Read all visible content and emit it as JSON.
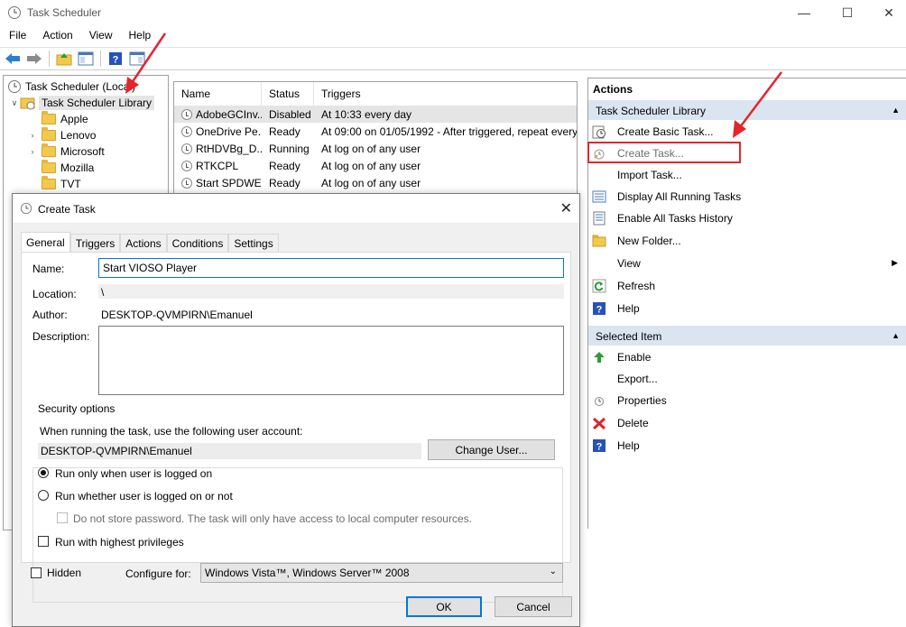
{
  "window": {
    "title": "Task Scheduler",
    "minimize": "—",
    "maximize": "☐",
    "close": "✕"
  },
  "menu": [
    "File",
    "Action",
    "View",
    "Help"
  ],
  "tree": {
    "root": "Task Scheduler (Local)",
    "library": "Task Scheduler Library",
    "folders": [
      "Apple",
      "Lenovo",
      "Microsoft",
      "Mozilla",
      "TVT"
    ]
  },
  "list": {
    "columns": [
      "Name",
      "Status",
      "Triggers"
    ],
    "rows": [
      {
        "name": "AdobeGCInv...",
        "status": "Disabled",
        "trigger": "At 10:33 every day"
      },
      {
        "name": "OneDrive Pe...",
        "status": "Ready",
        "trigger": "At 09:00 on 01/05/1992 - After triggered, repeat every"
      },
      {
        "name": "RtHDVBg_D...",
        "status": "Running",
        "trigger": "At log on of any user"
      },
      {
        "name": "RTKCPL",
        "status": "Ready",
        "trigger": "At log on of any user"
      },
      {
        "name": "Start SPDWE...",
        "status": "Ready",
        "trigger": "At log on of any user"
      }
    ]
  },
  "actions": {
    "header": "Actions",
    "section1": "Task Scheduler Library",
    "items1": [
      "Create Basic Task...",
      "Create Task...",
      "Import Task...",
      "Display All Running Tasks",
      "Enable All Tasks History",
      "New Folder...",
      "View",
      "Refresh",
      "Help"
    ],
    "section2": "Selected Item",
    "items2": [
      "Enable",
      "Export...",
      "Properties",
      "Delete",
      "Help"
    ]
  },
  "dialog": {
    "title": "Create Task",
    "tabs": [
      "General",
      "Triggers",
      "Actions",
      "Conditions",
      "Settings"
    ],
    "name_label": "Name:",
    "name_value": "Start VIOSO Player",
    "location_label": "Location:",
    "location_value": "\\",
    "author_label": "Author:",
    "author_value": "DESKTOP-QVMPIRN\\Emanuel",
    "description_label": "Description:",
    "security_title": "Security options",
    "security_prompt": "When running the task, use the following user account:",
    "account_value": "DESKTOP-QVMPIRN\\Emanuel",
    "change_user": "Change User...",
    "radio_logged_on": "Run only when user is logged on",
    "radio_whether": "Run whether user is logged on or not",
    "no_store_pw": "Do not store password.  The task will only have access to local computer resources.",
    "highest_priv": "Run with highest privileges",
    "hidden": "Hidden",
    "configure_label": "Configure for:",
    "configure_value": "Windows Vista™, Windows Server™ 2008",
    "ok": "OK",
    "cancel": "Cancel"
  },
  "colors": {
    "accent": "#0078d7",
    "annotation": "#e3262d",
    "section_bg": "#dbe5f1"
  }
}
